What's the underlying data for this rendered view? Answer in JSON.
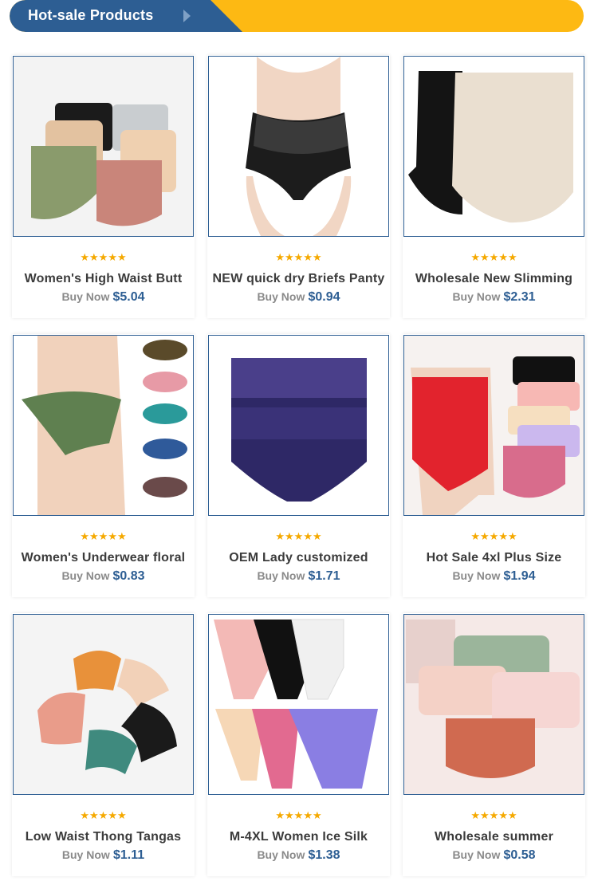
{
  "header": {
    "title": "Hot-sale Products",
    "arrow_icon": "play-arrow-icon",
    "tab_color": "#2d5e93",
    "bar_color": "#fdb913"
  },
  "rating_stars": "★★★★★",
  "buy_label": "Buy Now",
  "products": [
    {
      "name": "Women's High Waist Butt",
      "price": "$5.04"
    },
    {
      "name": "NEW quick dry Briefs Panty",
      "price": "$0.94"
    },
    {
      "name": "Wholesale New Slimming",
      "price": "$2.31"
    },
    {
      "name": "Women's Underwear floral",
      "price": "$0.83"
    },
    {
      "name": "OEM Lady customized",
      "price": "$1.71"
    },
    {
      "name": "Hot Sale 4xl Plus Size",
      "price": "$1.94"
    },
    {
      "name": "Low Waist Thong Tangas",
      "price": "$1.11"
    },
    {
      "name": "M-4XL Women Ice Silk",
      "price": "$1.38"
    },
    {
      "name": "Wholesale summer",
      "price": "$0.58"
    }
  ]
}
